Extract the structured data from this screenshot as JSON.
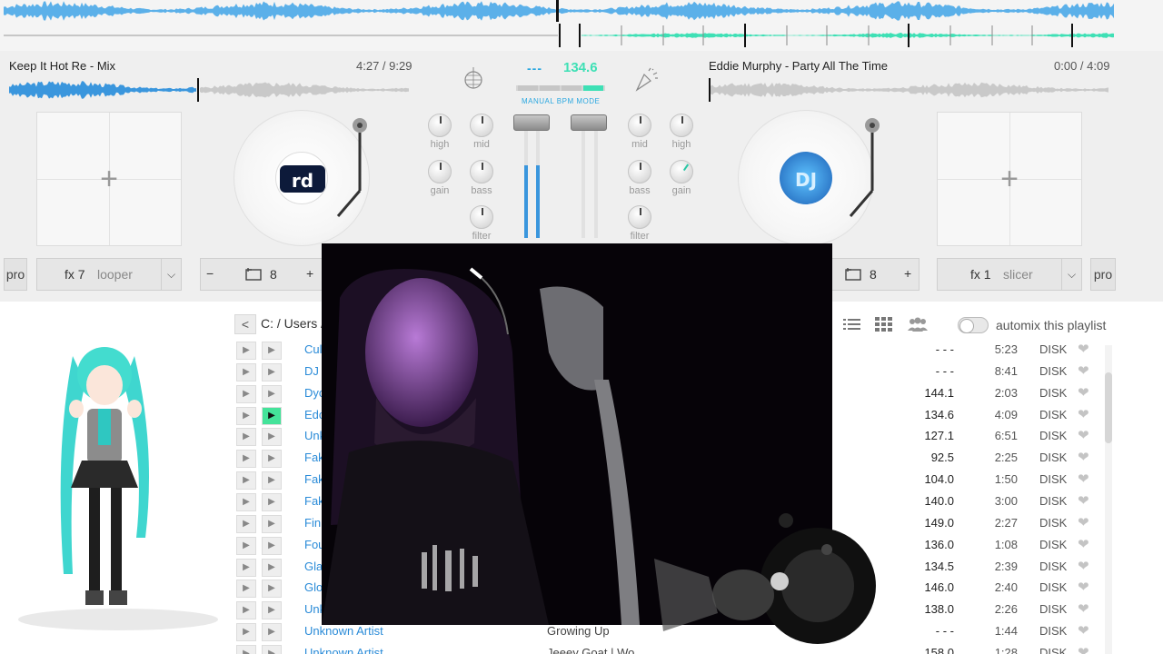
{
  "deck_left": {
    "title": "Keep It Hot Re - Mix",
    "time": "4:27 / 9:29",
    "label_art": "rd",
    "fx_number": "fx 7",
    "fx_name": "looper",
    "loop_minus": "−",
    "loop_value": "8",
    "loop_plus": "+",
    "pro_label": "pro"
  },
  "deck_right": {
    "title": "Eddie Murphy - Party All The Time",
    "time": "0:00 / 4:09",
    "label_art": "DJ",
    "fx_number": "fx 1",
    "fx_name": "slicer",
    "loop_value": "8",
    "loop_plus": "+",
    "pro_label": "pro"
  },
  "mixer": {
    "bpm_left": "---",
    "bpm_right": "134.6",
    "bpm_mode": "MANUAL BPM MODE",
    "knobs_left": [
      "high",
      "mid",
      "gain",
      "bass",
      "filter"
    ],
    "knobs_right": [
      "mid",
      "high",
      "bass",
      "gain",
      "filter"
    ],
    "accent": "#3a96dd",
    "bpm_color": "#3ee0b5"
  },
  "library": {
    "back": "<",
    "path": "C: / Users /",
    "automix_label": "automix this playlist",
    "icons": [
      "list-icon",
      "grid-icon",
      "users-icon"
    ],
    "rows": [
      {
        "artist": "Cul",
        "title": "",
        "bpm": "- - -",
        "dur": "5:23",
        "src": "DISK",
        "active": false
      },
      {
        "artist": "DJ",
        "title": "",
        "bpm": "- - -",
        "dur": "8:41",
        "src": "DISK",
        "active": false
      },
      {
        "artist": "Dyc",
        "title": "",
        "bpm": "144.1",
        "dur": "2:03",
        "src": "DISK",
        "active": false
      },
      {
        "artist": "Edc",
        "title": "",
        "bpm": "134.6",
        "dur": "4:09",
        "src": "DISK",
        "active": true
      },
      {
        "artist": "Unk",
        "title": "",
        "bpm": "127.1",
        "dur": "6:51",
        "src": "DISK",
        "active": false
      },
      {
        "artist": "Fak",
        "title": "",
        "bpm": "92.5",
        "dur": "2:25",
        "src": "DISK",
        "active": false
      },
      {
        "artist": "Fak",
        "title": "",
        "bpm": "104.0",
        "dur": "1:50",
        "src": "DISK",
        "active": false
      },
      {
        "artist": "Fak",
        "title": "",
        "bpm": "140.0",
        "dur": "3:00",
        "src": "DISK",
        "active": false
      },
      {
        "artist": "Fin",
        "title": "",
        "bpm": "149.0",
        "dur": "2:27",
        "src": "DISK",
        "active": false
      },
      {
        "artist": "Fou",
        "title": "",
        "bpm": "136.0",
        "dur": "1:08",
        "src": "DISK",
        "active": false
      },
      {
        "artist": "Gla",
        "title": "",
        "bpm": "134.5",
        "dur": "2:39",
        "src": "DISK",
        "active": false
      },
      {
        "artist": "Glo",
        "title": "",
        "bpm": "146.0",
        "dur": "2:40",
        "src": "DISK",
        "active": false
      },
      {
        "artist": "Unk",
        "title": "",
        "bpm": "138.0",
        "dur": "2:26",
        "src": "DISK",
        "active": false
      },
      {
        "artist": "Unknown Artist",
        "title": "Growing Up",
        "bpm": "- - -",
        "dur": "1:44",
        "src": "DISK",
        "active": false
      },
      {
        "artist": "Unknown Artist",
        "title": "Jeeey Goat | Wo",
        "bpm": "158.0",
        "dur": "1:28",
        "src": "DISK",
        "active": false
      }
    ]
  }
}
